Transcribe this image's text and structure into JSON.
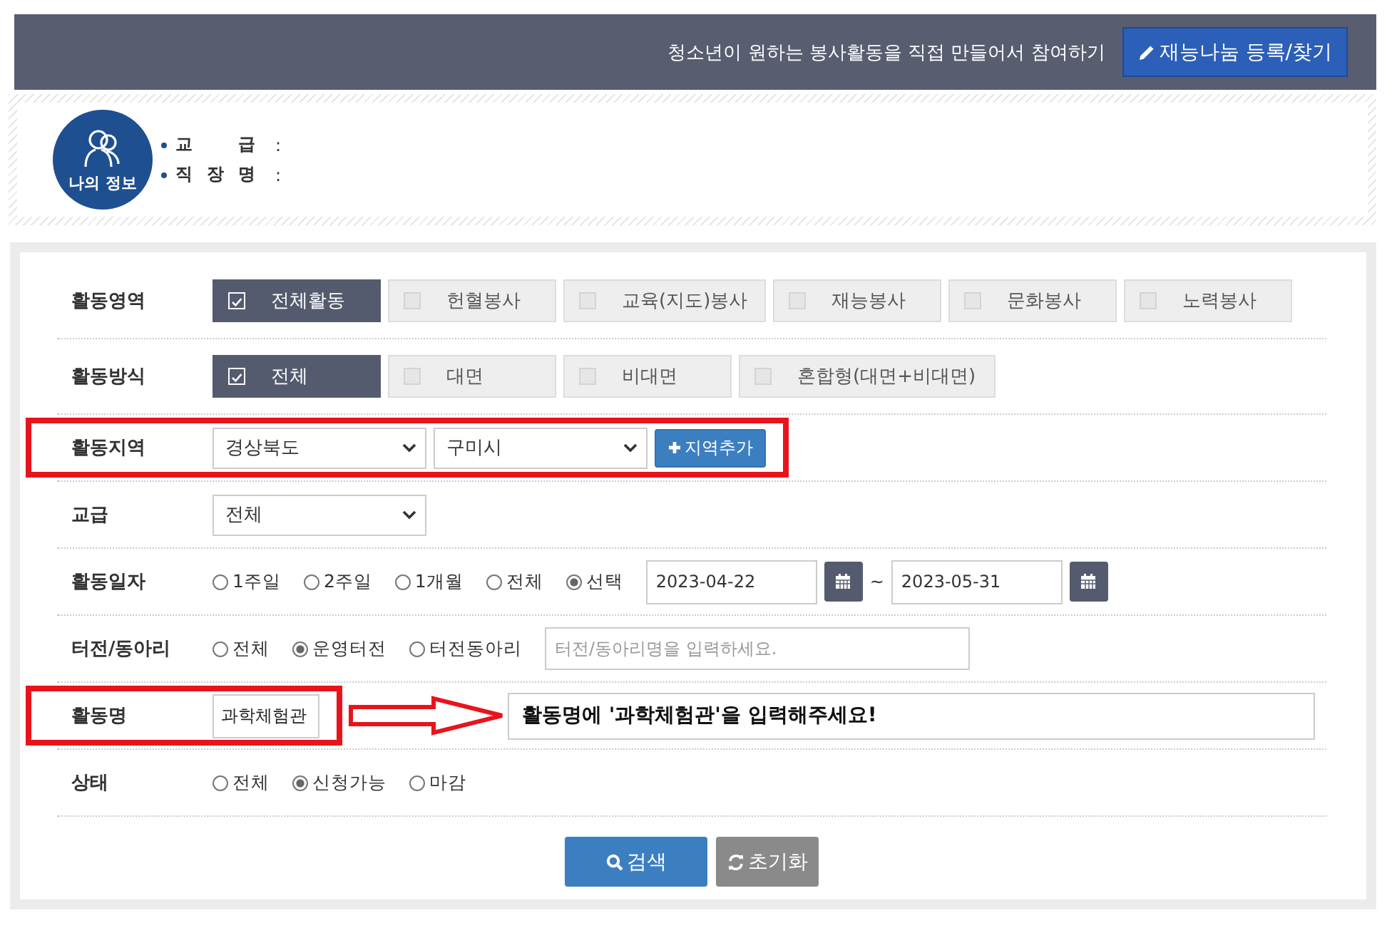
{
  "header": {
    "tagline": "청소년이 원하는 봉사활동을 직접 만들어서 참여하기",
    "button": "재능나눔 등록/찾기"
  },
  "profile": {
    "badge": "나의 정보",
    "fields": [
      {
        "label": "교 급",
        "colon": ":"
      },
      {
        "label": "직 장 명",
        "colon": ":"
      }
    ]
  },
  "filters": [
    {
      "label": "활동영역",
      "highlighted": false,
      "controls": [
        {
          "kind": "chip",
          "label": "전체활동",
          "selected": true
        },
        {
          "kind": "chip",
          "label": "헌혈봉사",
          "selected": false
        },
        {
          "kind": "chip",
          "label": "교육(지도)봉사",
          "selected": false
        },
        {
          "kind": "chip",
          "label": "재능봉사",
          "selected": false
        },
        {
          "kind": "chip",
          "label": "문화봉사",
          "selected": false
        },
        {
          "kind": "chip",
          "label": "노력봉사",
          "selected": false
        }
      ]
    },
    {
      "label": "활동방식",
      "highlighted": false,
      "controls": [
        {
          "kind": "chip",
          "label": "전체",
          "selected": true
        },
        {
          "kind": "chip",
          "label": "대면",
          "selected": false
        },
        {
          "kind": "chip",
          "label": "비대면",
          "selected": false
        },
        {
          "kind": "chip",
          "label": "혼합형(대면+비대면)",
          "selected": false
        }
      ]
    },
    {
      "label": "활동지역",
      "highlighted": true,
      "controls": [
        {
          "kind": "select",
          "value": "경상북도"
        },
        {
          "kind": "select",
          "value": "구미시"
        },
        {
          "kind": "add",
          "label": "지역추가"
        }
      ]
    },
    {
      "label": "교급",
      "highlighted": false,
      "controls": [
        {
          "kind": "select",
          "value": "전체"
        }
      ]
    },
    {
      "label": "활동일자",
      "highlighted": false,
      "controls": [
        {
          "kind": "radio",
          "label": "1주일",
          "selected": false
        },
        {
          "kind": "radio",
          "label": "2주일",
          "selected": false
        },
        {
          "kind": "radio",
          "label": "1개월",
          "selected": false
        },
        {
          "kind": "radio",
          "label": "전체",
          "selected": false
        },
        {
          "kind": "radio",
          "label": "선택",
          "selected": true
        },
        {
          "kind": "date",
          "value": "2023-04-22"
        },
        {
          "kind": "text",
          "text": "~"
        },
        {
          "kind": "date",
          "value": "2023-05-31"
        }
      ]
    },
    {
      "label": "터전/동아리",
      "highlighted": false,
      "controls": [
        {
          "kind": "radio",
          "label": "전체",
          "selected": false
        },
        {
          "kind": "radio",
          "label": "운영터전",
          "selected": true
        },
        {
          "kind": "radio",
          "label": "터전동아리",
          "selected": false
        },
        {
          "kind": "input",
          "placeholder": "터전/동아리명을 입력하세요."
        }
      ]
    },
    {
      "label": "활동명",
      "highlighted": true,
      "controls": [
        {
          "kind": "name",
          "value": "과학체험관"
        }
      ],
      "annotation": "활동명에 '과학체험관'을 입력해주세요!"
    },
    {
      "label": "상태",
      "highlighted": false,
      "controls": [
        {
          "kind": "radio",
          "label": "전체",
          "selected": false
        },
        {
          "kind": "radio",
          "label": "신청가능",
          "selected": true
        },
        {
          "kind": "radio",
          "label": "마감",
          "selected": false
        }
      ]
    }
  ],
  "buttons": [
    {
      "kind": "search",
      "label": "검색"
    },
    {
      "kind": "reset",
      "label": "초기화"
    }
  ]
}
